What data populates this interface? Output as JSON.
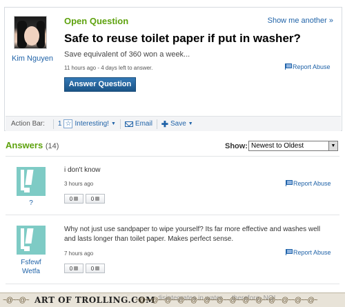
{
  "question": {
    "status_label": "Open Question",
    "show_more": "Show me another »",
    "title": "Safe to reuse toilet paper if put in washer?",
    "detail": "Save equivalent of 360 won a week...",
    "meta": "11 hours ago - 4 days left to answer.",
    "report_label": "Report Abuse",
    "answer_button": "Answer Question",
    "user": "Kim Nguyen"
  },
  "action_bar": {
    "label": "Action Bar:",
    "interesting_count": "1",
    "interesting_label": "Interesting!",
    "email_label": "Email",
    "save_label": "Save"
  },
  "answers_section": {
    "title": "Answers",
    "count": "(14)",
    "show_label": "Show:",
    "sort_value": "Newest to Oldest"
  },
  "answers": [
    {
      "user_line1": "?",
      "user_line2": "",
      "text": "i don't know",
      "time": "3 hours ago",
      "report_label": "Report Abuse",
      "up": "0",
      "down": "0"
    },
    {
      "user_line1": "Fsfewf",
      "user_line2": "Wetfa",
      "text": "Why not just use sandpaper to wipe yourself? Its far more effective and washes well and lasts longer than toilet paper. Makes perfect sense.",
      "time": "7 hours ago",
      "report_label": "Report Abuse",
      "up": "0",
      "down": "0"
    }
  ],
  "footer": {
    "brand": "ART OF TROLLING.COM",
    "bleed_text": "Are you serious ... toilet paper disintegrates in water ... therefore, NO!"
  },
  "colors": {
    "accent_green": "#5ea20e",
    "link_blue": "#2063a8",
    "button_blue": "#1f5d93",
    "avatar_teal": "#7ecbc5"
  }
}
